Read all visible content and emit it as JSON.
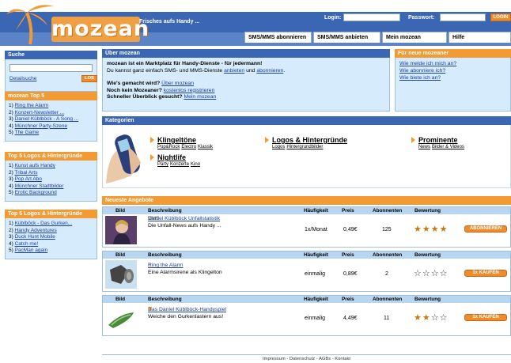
{
  "header": {
    "logo_text": "mozean",
    "tagline": "Frisches aufs Handy ...",
    "login_label": "Login:",
    "password_label": "Passwort:",
    "login_button": "LOGIN",
    "tabs": [
      "SMS/MMS abonnieren",
      "SMS/MMS anbieten",
      "Mein mozean",
      "Hilfe"
    ]
  },
  "sidebar": {
    "search": {
      "title": "Suche",
      "details_link": "Detailsuche",
      "button": "LOS"
    },
    "top5": {
      "title": "mozean Top 5",
      "items": [
        "Ring the Alarm",
        "Konzert-Newsletter ...",
        "Daniel Küblböck - A Song ...",
        "Münchner Party-Szene",
        "The Game"
      ]
    },
    "top5_logos_1": {
      "title": "Top 5 Logos & Hintergründe",
      "items": [
        "Kunst aufs Handy",
        "Tribal Arts",
        "Pop Art Abo",
        "Münchner Stadtbilder",
        "Erotic Background"
      ]
    },
    "top5_logos_2": {
      "title": "Top 5 Logos & Hintergründe",
      "items": [
        "Küblböck - Das Gurken...",
        "Handy Adventures",
        "Duck Hunt Mobile",
        "Catch me!",
        "PacMan again"
      ]
    }
  },
  "about": {
    "title": "Über mozean",
    "headline": "mozean ist ein Marktplatz für Handy-Dienste - für jedermann!",
    "line2_prefix": "Du kannst ganz einfach SMS- und MMS-Dienste",
    "line2_link1": "anbieten",
    "line2_mid": "und",
    "line2_link2": "abonnieren",
    "q1": "Wie's gemacht wird?",
    "q1_link": "Über mozean",
    "q2": "Noch kein Mozeaner?",
    "q2_link": "kostenlos registrieren",
    "q3": "Schneller Überblick gesucht?",
    "q3_link": "Mein mozean"
  },
  "new_users": {
    "title": "Für neue mozeaner",
    "links": [
      "Wie melde ich mich an?",
      "Wie abonniere ich?",
      "Wie biete ich an?"
    ]
  },
  "categories": {
    "title": "Kategorien",
    "items": [
      {
        "name": "Klingeltöne",
        "subs": [
          "Pop&Rock",
          "Electro",
          "Klassik"
        ]
      },
      {
        "name": "Logos & Hintergründe",
        "subs": [
          "Logos",
          "Hintergrundbilder"
        ]
      },
      {
        "name": "Prominente",
        "subs": [
          "News",
          "Bilder & Videos"
        ]
      },
      {
        "name": "Nightlife",
        "subs": [
          "Party",
          "Konzerte",
          "Kino"
        ]
      }
    ]
  },
  "offers": {
    "title": "Neueste Angebote",
    "columns": [
      "Bild",
      "Beschreibung",
      "Häufigkeit",
      "Preis",
      "Abonnenten",
      "Bewertung"
    ],
    "rows": [
      {
        "title": "Daniel Küblböck Unfallstatistik",
        "desc": "Die Unfall-News aufs Handy ...",
        "freq": "1x/Monat",
        "price": "0,49€",
        "subs": "125",
        "rating": 4,
        "button": "ABONNIEREN"
      },
      {
        "title": "Ring the Alarm",
        "desc": "Eine Alarmsirene als Klingelton",
        "freq": "einmalig",
        "price": "0,89€",
        "subs": "2",
        "rating": 0,
        "button": "1x KAUFEN"
      },
      {
        "title": "Das Daniel Küblböck-Handyspiel",
        "desc": "Weiche den Gurkenlastern aus!",
        "freq": "einmalig",
        "price": "4,49€",
        "subs": "11",
        "rating": 2,
        "button": "1x KAUFEN"
      }
    ]
  },
  "footer": {
    "links": [
      "Impressum",
      "Datenschutz",
      "AGBs",
      "Kontakt"
    ],
    "separator": "-"
  },
  "colors": {
    "header_blue": "#3b66b3",
    "accent_orange": "#f49a33",
    "panel_blue": "#d6ebfb"
  }
}
